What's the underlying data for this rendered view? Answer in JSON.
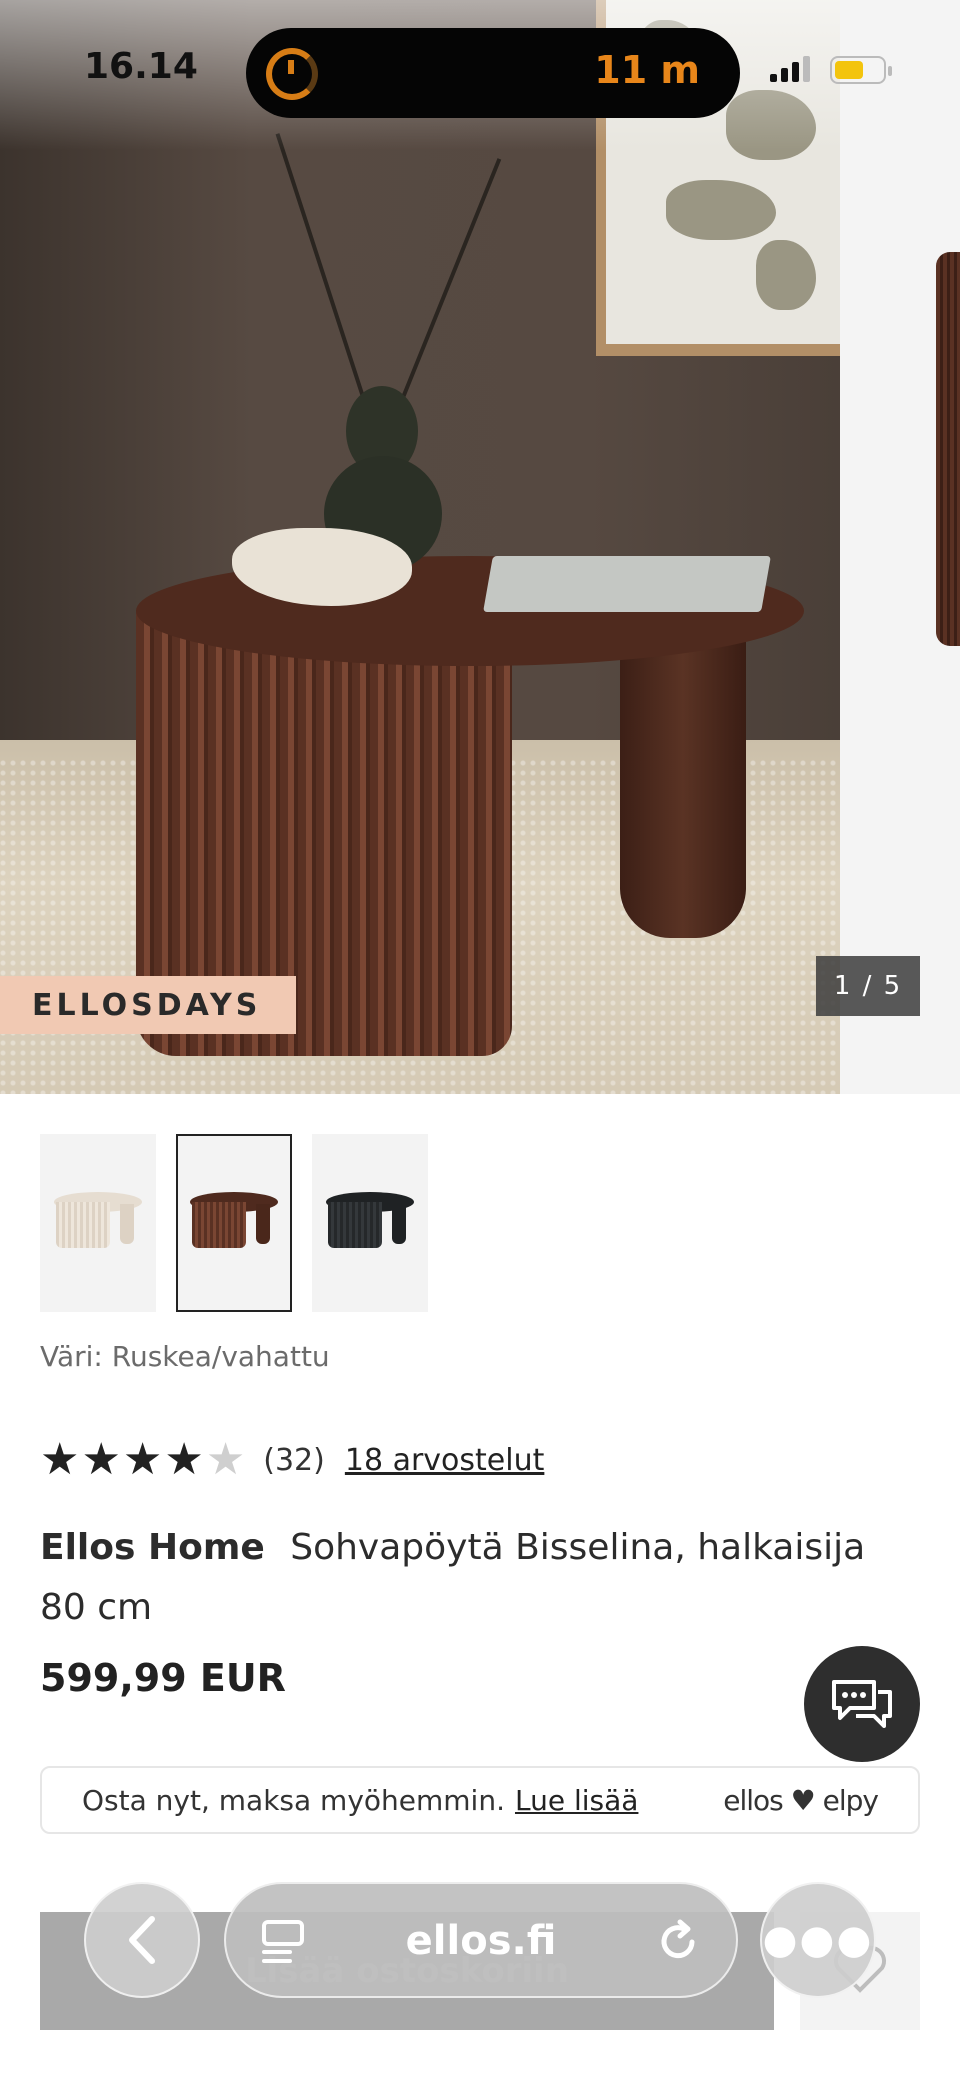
{
  "status_bar": {
    "time": "16.14",
    "timer_label": "11 m"
  },
  "gallery": {
    "badge": "ELLOSDAYS",
    "counter": "1 / 5"
  },
  "variants": {
    "color_label": "Väri: Ruskea/vahattu",
    "items": [
      {
        "color": "#e6ddd1"
      },
      {
        "color": "#5b2f22"
      },
      {
        "color": "#1f2224"
      }
    ],
    "selected_index": 1
  },
  "rating": {
    "value": 4,
    "max": 5,
    "count": "(32)",
    "reviews_link": "18 arvostelut"
  },
  "product": {
    "brand": "Ellos Home",
    "name": "Sohvapöytä Bisselina, halkaisija 80 cm",
    "price": "599,99 EUR"
  },
  "payment_banner": {
    "text": "Osta nyt, maksa myöhemmin.",
    "link": "Lue lisää",
    "provider": "ellos ♥ elpy"
  },
  "cart": {
    "label": "Lisää ostoskoriin"
  },
  "browser": {
    "domain": "ellos.fi"
  },
  "colors": {
    "accent_timer": "#e8861a",
    "badge_bg": "#f1c9b3",
    "battery": "#f3c40d"
  },
  "icons": [
    "timer-icon",
    "signal-icon",
    "battery-icon",
    "chat-icon",
    "back-icon",
    "tabs-icon",
    "reload-icon",
    "more-icon",
    "heart-icon"
  ]
}
